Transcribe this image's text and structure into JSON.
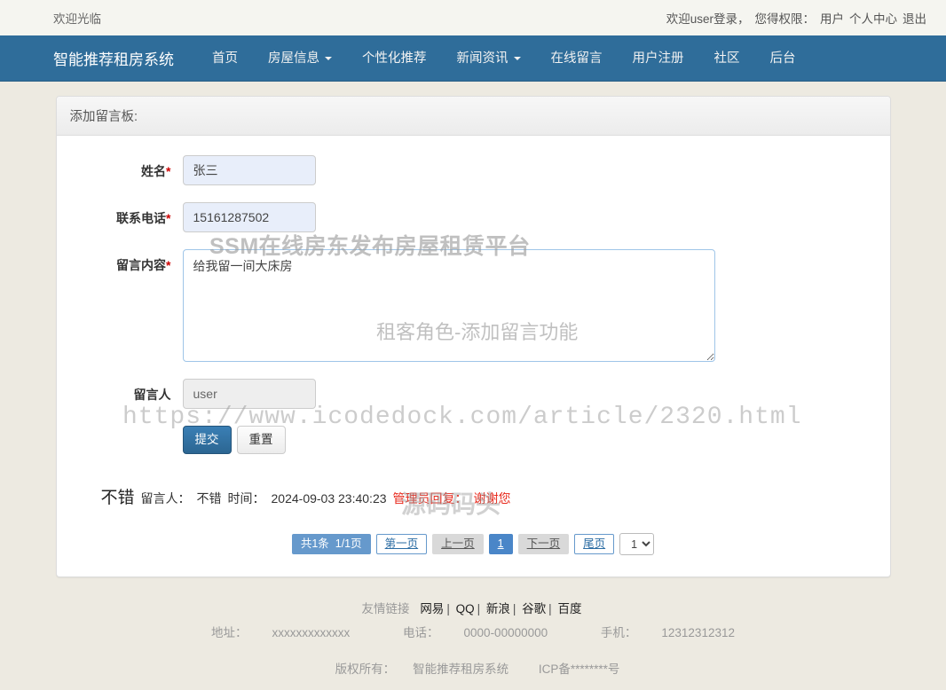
{
  "topbar": {
    "welcome": "欢迎光临",
    "login_greeting": "欢迎user登录，",
    "role_label": "您得权限：",
    "role_value": "用户",
    "profile_link": "个人中心",
    "logout_link": "退出"
  },
  "navbar": {
    "brand": "智能推荐租房系统",
    "items": [
      {
        "label": "首页",
        "has_caret": false
      },
      {
        "label": "房屋信息",
        "has_caret": true
      },
      {
        "label": "个性化推荐",
        "has_caret": false
      },
      {
        "label": "新闻资讯",
        "has_caret": true
      },
      {
        "label": "在线留言",
        "has_caret": false
      },
      {
        "label": "用户注册",
        "has_caret": false
      },
      {
        "label": "社区",
        "has_caret": false
      },
      {
        "label": "后台",
        "has_caret": false
      }
    ],
    "bg_color": "#2f6d9a"
  },
  "panel": {
    "heading": "添加留言板:"
  },
  "form": {
    "name": {
      "label": "姓名",
      "required": "*",
      "value": "张三"
    },
    "phone": {
      "label": "联系电话",
      "required": "*",
      "value": "15161287502"
    },
    "content": {
      "label": "留言内容",
      "required": "*",
      "value": "给我留一间大床房"
    },
    "author": {
      "label": "留言人",
      "value": "user"
    },
    "submit_label": "提交",
    "reset_label": "重置"
  },
  "messages": [
    {
      "title": "不错",
      "author_label": "留言人：",
      "author": "不错",
      "time_label": "时间：",
      "time": "2024-09-03 23:40:23",
      "reply_label": "管理员回复：",
      "reply": "谢谢您",
      "reply_color": "#e8291c"
    }
  ],
  "pagination": {
    "total_text": "共1条",
    "page_text": "1/1页",
    "first": "第一页",
    "prev": "上一页",
    "current": "1",
    "next": "下一页",
    "last": "尾页",
    "select_value": "1",
    "select_options": [
      "1"
    ]
  },
  "footer": {
    "links_label": "友情链接",
    "links": [
      "网易",
      "QQ",
      "新浪",
      "谷歌",
      "百度"
    ],
    "separator": "|",
    "address_label": "地址：",
    "address": "xxxxxxxxxxxxx",
    "tel_label": "电话：",
    "tel": "0000-00000000",
    "mobile_label": "手机：",
    "mobile": "12312312312",
    "copyright_label": "版权所有：",
    "copyright": "智能推荐租房系统",
    "icp": "ICP备********号"
  },
  "watermarks": {
    "platform": "SSM在线房东发布房屋租赁平台",
    "feature": "租客角色-添加留言功能",
    "url": "https://www.icodedock.com/article/2320.html",
    "site": "源码码头"
  }
}
